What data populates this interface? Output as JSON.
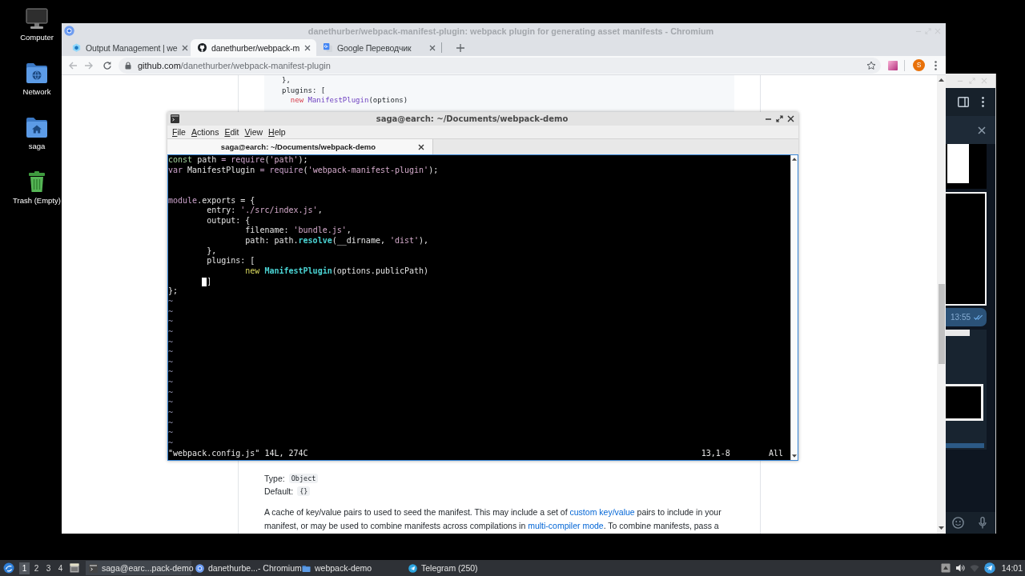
{
  "desktop_icons": [
    {
      "kind": "computer",
      "label": "Computer"
    },
    {
      "kind": "network",
      "label": "Network"
    },
    {
      "kind": "home",
      "label": "saga"
    },
    {
      "kind": "trash",
      "label": "Trash (Empty)"
    }
  ],
  "browser": {
    "title": "danethurber/webpack-manifest-plugin: webpack plugin for generating asset manifests - Chromium",
    "tabs": [
      {
        "kind": "webpack",
        "label": "Output Management | we",
        "selected": false
      },
      {
        "kind": "github",
        "label": "danethurber/webpack-m",
        "selected": true
      },
      {
        "kind": "translate",
        "label": "Google Переводчик",
        "selected": false
      }
    ],
    "address": {
      "host": "github.com",
      "path": "/danethurber/webpack-manifest-plugin"
    },
    "profile": "S",
    "page": {
      "code": [
        [
          {
            "kind": "plain",
            "text": "},"
          }
        ],
        [
          {
            "kind": "plain",
            "text": "plugins: ["
          }
        ],
        [
          {
            "kind": "keyword",
            "text": "  new"
          },
          {
            "kind": "entity",
            "text": " ManifestPlugin"
          },
          {
            "kind": "plain",
            "text": "(options)"
          }
        ]
      ],
      "fields": [
        {
          "label": "Type:",
          "value": "Object"
        },
        {
          "label": "Default:",
          "value": "{}"
        }
      ],
      "description": [
        {
          "kind": "text",
          "text": "A cache of key/value pairs to used to seed the manifest. This may include a set of "
        },
        {
          "kind": "link",
          "text": "custom key/value"
        },
        {
          "kind": "text",
          "text": " pairs to include in your manifest, or may be used to combine manifests across compilations in "
        },
        {
          "kind": "link",
          "text": "multi-compiler mode"
        },
        {
          "kind": "text",
          "text": ". To combine manifests, pass a"
        }
      ]
    }
  },
  "terminal": {
    "title": "saga@earch: ~/Documents/webpack-demo",
    "menu": [
      "File",
      "Actions",
      "Edit",
      "View",
      "Help"
    ],
    "tabs": [
      {
        "label": "saga@earch: ~/Documents/webpack-demo",
        "selected": true
      }
    ],
    "lines": [
      {
        "kind": "code",
        "segments": [
          {
            "kind": "keyword",
            "text": "const"
          },
          {
            "kind": "plain",
            "text": " path "
          },
          {
            "kind": "special",
            "text": "= require"
          },
          {
            "kind": "plain",
            "text": "("
          },
          {
            "kind": "string",
            "text": "'path'"
          },
          {
            "kind": "plain",
            "text": ");"
          }
        ]
      },
      {
        "kind": "code",
        "segments": [
          {
            "kind": "special",
            "text": "var"
          },
          {
            "kind": "plain",
            "text": " ManifestPlugin "
          },
          {
            "kind": "special",
            "text": "= require"
          },
          {
            "kind": "plain",
            "text": "("
          },
          {
            "kind": "string",
            "text": "'webpack-manifest-plugin'"
          },
          {
            "kind": "plain",
            "text": ");"
          }
        ]
      },
      {
        "kind": "blank"
      },
      {
        "kind": "blank"
      },
      {
        "kind": "code",
        "segments": [
          {
            "kind": "special",
            "text": "module"
          },
          {
            "kind": "plain",
            "text": ".exports = {"
          }
        ]
      },
      {
        "kind": "code",
        "segments": [
          {
            "kind": "plain",
            "text": "        entry: "
          },
          {
            "kind": "string",
            "text": "'./src/index.js'"
          },
          {
            "kind": "plain",
            "text": ","
          }
        ]
      },
      {
        "kind": "code",
        "segments": [
          {
            "kind": "plain",
            "text": "        output: {"
          }
        ]
      },
      {
        "kind": "code",
        "segments": [
          {
            "kind": "plain",
            "text": "                filename: "
          },
          {
            "kind": "string",
            "text": "'bundle.js'"
          },
          {
            "kind": "plain",
            "text": ","
          }
        ]
      },
      {
        "kind": "code",
        "segments": [
          {
            "kind": "plain",
            "text": "                path: path."
          },
          {
            "kind": "function",
            "text": "resolve"
          },
          {
            "kind": "plain",
            "text": "(__dirname, "
          },
          {
            "kind": "string",
            "text": "'dist'"
          },
          {
            "kind": "plain",
            "text": "),"
          }
        ]
      },
      {
        "kind": "code",
        "segments": [
          {
            "kind": "plain",
            "text": "        },"
          }
        ]
      },
      {
        "kind": "code",
        "segments": [
          {
            "kind": "plain",
            "text": "        plugins: ["
          }
        ]
      },
      {
        "kind": "code",
        "segments": [
          {
            "kind": "statement",
            "text": "                new"
          },
          {
            "kind": "function",
            "text": " ManifestPlugin"
          },
          {
            "kind": "plain",
            "text": "(options.publicPath)"
          }
        ]
      },
      {
        "kind": "code",
        "segments": [
          {
            "kind": "tab",
            "cursor": true
          },
          {
            "kind": "plain",
            "text": "]"
          }
        ]
      },
      {
        "kind": "code",
        "segments": [
          {
            "kind": "plain",
            "text": "};"
          }
        ]
      },
      {
        "kind": "filler",
        "text": "~"
      },
      {
        "kind": "filler",
        "text": "~"
      },
      {
        "kind": "filler",
        "text": "~"
      },
      {
        "kind": "filler",
        "text": "~"
      },
      {
        "kind": "filler",
        "text": "~"
      },
      {
        "kind": "filler",
        "text": "~"
      },
      {
        "kind": "filler",
        "text": "~"
      },
      {
        "kind": "filler",
        "text": "~"
      },
      {
        "kind": "filler",
        "text": "~"
      },
      {
        "kind": "filler",
        "text": "~"
      },
      {
        "kind": "filler",
        "text": "~"
      },
      {
        "kind": "filler",
        "text": "~"
      },
      {
        "kind": "filler",
        "text": "~"
      },
      {
        "kind": "filler",
        "text": "~"
      },
      {
        "kind": "filler",
        "text": "~"
      }
    ],
    "status": {
      "message": "\"webpack.config.js\" 14L, 274C",
      "position": "13,1-8",
      "scroll": "All"
    }
  },
  "telegram": {
    "message": {
      "time": "13:55",
      "read": true
    }
  },
  "taskbar": {
    "workspaces": [
      {
        "label": "1",
        "selected": true
      },
      {
        "label": "2",
        "selected": false
      },
      {
        "label": "3",
        "selected": false
      },
      {
        "label": "4",
        "selected": false
      }
    ],
    "tasks": [
      {
        "kind": "terminal",
        "label": "saga@earc...pack-demo",
        "selected": true
      },
      {
        "kind": "browser",
        "label": "danethurbe...- Chromium",
        "selected": false
      },
      {
        "kind": "folder",
        "label": "webpack-demo",
        "selected": false
      },
      {
        "kind": "telegram",
        "label": "Telegram (250)",
        "selected": false
      }
    ],
    "clock": "14:01"
  }
}
